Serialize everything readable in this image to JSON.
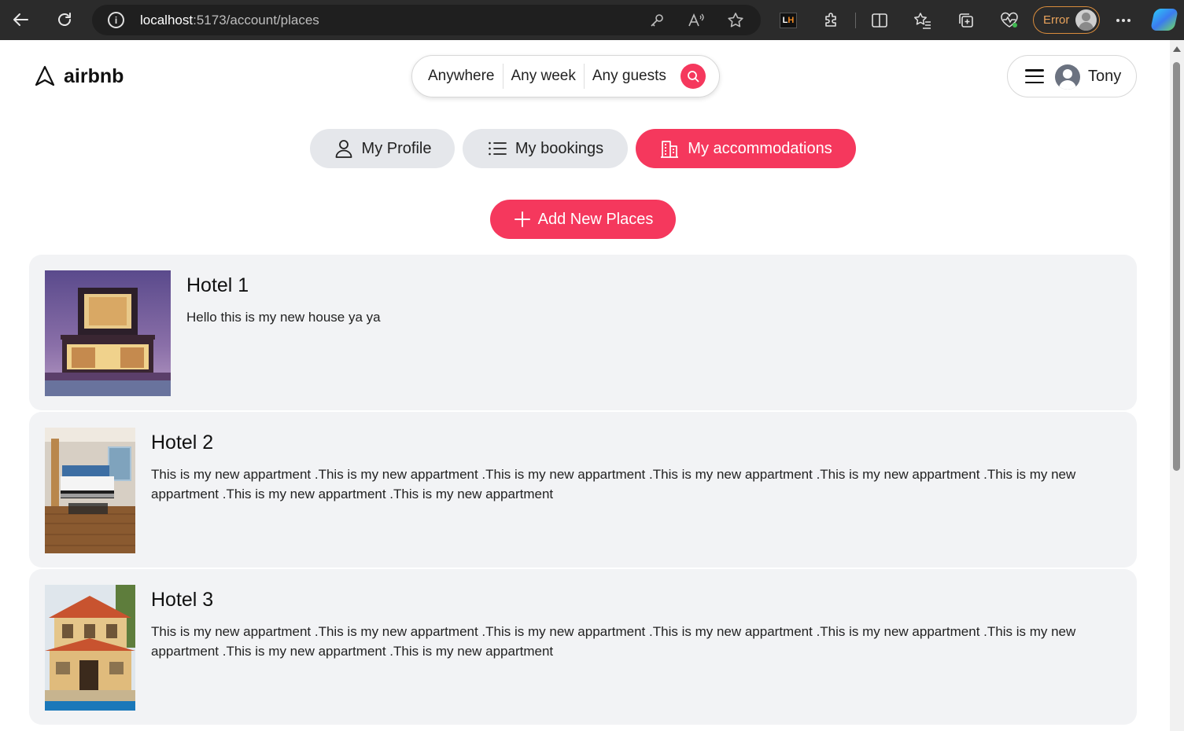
{
  "browser": {
    "url_host": "localhost",
    "url_path": ":5173/account/places",
    "profile_status": "Error",
    "icons": [
      "back-icon",
      "reload-icon",
      "info-icon",
      "key-icon",
      "read-aloud-icon",
      "favorite-star-icon",
      "lighthouse-icon",
      "extensions-icon",
      "split-screen-icon",
      "favorites-icon",
      "collections-icon",
      "performance-icon",
      "more-icon",
      "copilot-icon"
    ]
  },
  "header": {
    "logo_text": "airbnb",
    "search": {
      "where": "Anywhere",
      "when": "Any week",
      "who": "Any guests"
    },
    "user_name": "Tony"
  },
  "tabs": [
    {
      "label": "My Profile",
      "icon": "user-icon",
      "active": false
    },
    {
      "label": "My bookings",
      "icon": "list-icon",
      "active": false
    },
    {
      "label": "My accommodations",
      "icon": "building-icon",
      "active": true
    }
  ],
  "add_button_label": "Add New Places",
  "places": [
    {
      "title": "Hotel 1",
      "description": "Hello this is my new house ya ya",
      "photo": "modern-house-photo"
    },
    {
      "title": "Hotel 2",
      "description": "This is my new appartment .This is my new appartment .This is my new appartment .This is my new appartment .This is my new appartment .This is my new appartment .This is my new appartment .This is my new appartment",
      "photo": "hotel-room-photo"
    },
    {
      "title": "Hotel 3",
      "description": "This is my new appartment .This is my new appartment .This is my new appartment .This is my new appartment .This is my new appartment .This is my new appartment .This is my new appartment .This is my new appartment",
      "photo": "villa-photo"
    }
  ],
  "colors": {
    "accent": "#f5385d",
    "tab_inactive": "#e5e7eb",
    "card_bg": "#f2f3f5",
    "chrome_bg": "#2b2b2b"
  }
}
